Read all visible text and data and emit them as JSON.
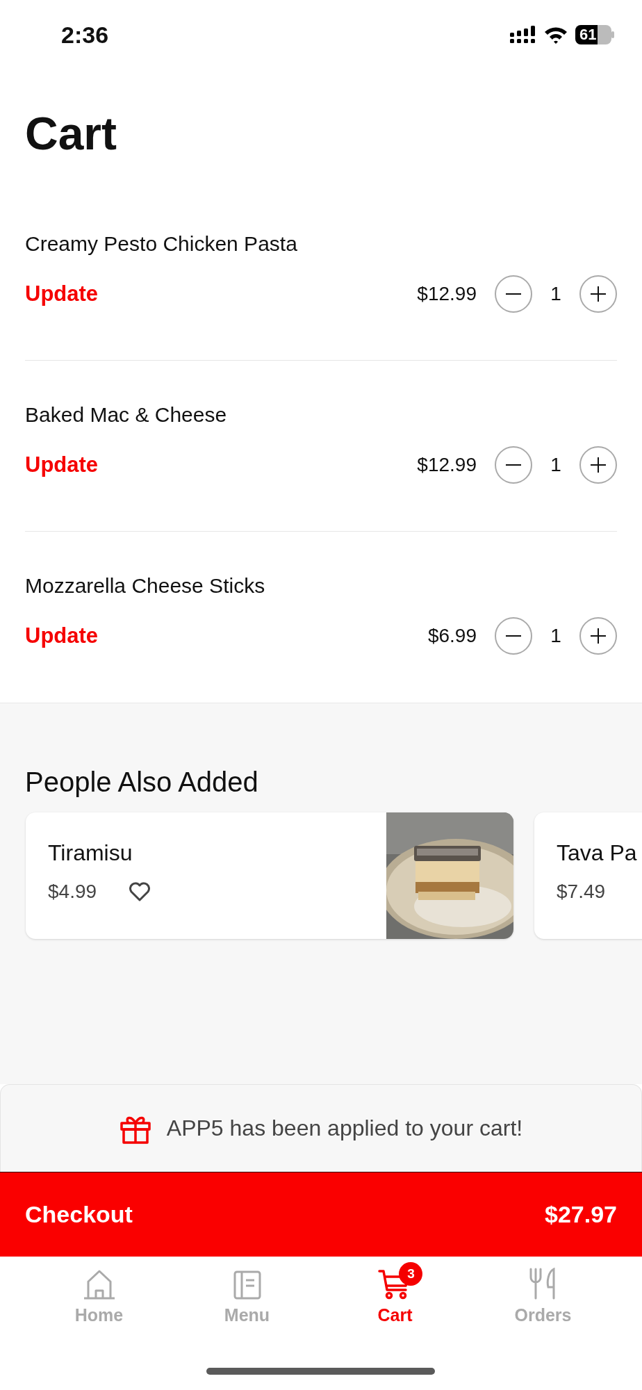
{
  "status_bar": {
    "time": "2:36",
    "battery": "61"
  },
  "title": "Cart",
  "cart_items": [
    {
      "name": "Creamy Pesto Chicken Pasta",
      "action": "Update",
      "price": "$12.99",
      "quantity": "1"
    },
    {
      "name": "Baked Mac & Cheese",
      "action": "Update",
      "price": "$12.99",
      "quantity": "1"
    },
    {
      "name": "Mozzarella Cheese Sticks",
      "action": "Update",
      "price": "$6.99",
      "quantity": "1"
    }
  ],
  "suggestions": {
    "title": "People Also Added",
    "items": [
      {
        "name": "Tiramisu",
        "price": "$4.99",
        "favorited": false
      },
      {
        "name": "Tava Pa",
        "price": "$7.49"
      }
    ]
  },
  "promo": {
    "message": "APP5 has been applied to your cart!"
  },
  "checkout": {
    "label": "Checkout",
    "total": "$27.97"
  },
  "tab_bar": [
    {
      "label": "Home",
      "kind": "home",
      "selected": false
    },
    {
      "label": "Menu",
      "kind": "menu",
      "selected": false
    },
    {
      "label": "Cart",
      "kind": "cart",
      "selected": true,
      "badge": "3"
    },
    {
      "label": "Orders",
      "kind": "orders",
      "selected": false
    }
  ]
}
